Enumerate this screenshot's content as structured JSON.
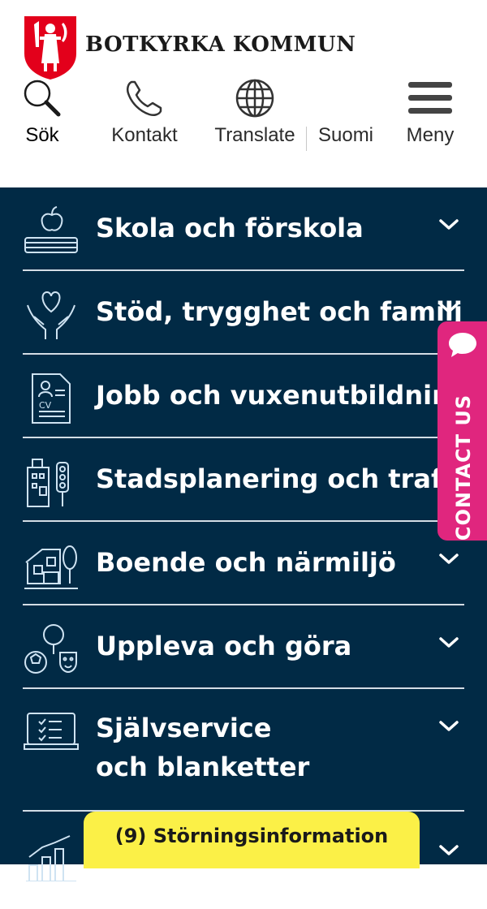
{
  "header": {
    "brand": "BOTKYRKA KOMMUN",
    "tools": {
      "search": "Sök",
      "contact": "Kontakt",
      "translate": "Translate",
      "finnish": "Suomi",
      "menu": "Meny"
    }
  },
  "nav": {
    "items": [
      {
        "label": "Skola och förskola",
        "icon": "school-icon"
      },
      {
        "label": "Stöd, trygghet och familj",
        "icon": "support-icon"
      },
      {
        "label": "Jobb och vuxenutbildning",
        "icon": "cv-icon"
      },
      {
        "label": "Stadsplanering och trafik",
        "icon": "city-planning-icon"
      },
      {
        "label": "Boende och närmiljö",
        "icon": "housing-icon"
      },
      {
        "label": "Uppleva och göra",
        "icon": "leisure-icon"
      },
      {
        "label_line1": "Självservice",
        "label_line2": "och blanketter",
        "icon": "self-service-icon"
      },
      {
        "icon": "statistics-icon"
      }
    ]
  },
  "contact_tab": {
    "label": "CONTACT US",
    "icon": "chat-icon",
    "color": "#e0267e"
  },
  "disruption": {
    "label": "(9) Störningsinformation",
    "color": "#fbf047"
  },
  "colors": {
    "nav_background": "#012a45",
    "brand_red": "#e3001b"
  }
}
